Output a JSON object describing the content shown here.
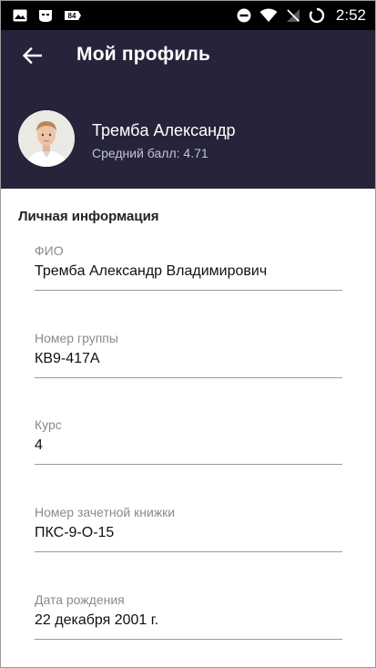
{
  "status_bar": {
    "time": "2:52",
    "left_icons": [
      "image-icon",
      "app-icon",
      "notification-count-icon"
    ],
    "notification_badge": "84",
    "right_icons": [
      "do-not-disturb-icon",
      "wifi-icon",
      "signal-icon",
      "battery-icon"
    ]
  },
  "header": {
    "back_icon": "arrow-left-icon",
    "title": "Мой профиль",
    "user_name": "Трембa Александр",
    "gpa_text": "Средний балл: 4.71"
  },
  "personal_info": {
    "section_title": "Личная информация",
    "fields": [
      {
        "label": "ФИО",
        "value": "Трембa Александр Владимирович"
      },
      {
        "label": "Номер группы",
        "value": "КВ9-417А"
      },
      {
        "label": "Курс",
        "value": "4"
      },
      {
        "label": "Номер зачетной книжки",
        "value": "ПКС-9-О-15"
      },
      {
        "label": "Дата рождения",
        "value": "22 декабря 2001 г."
      }
    ]
  },
  "colors": {
    "header_bg": "#25243a",
    "status_bar_bg": "#000000",
    "divider": "#9b9b9b",
    "label": "#8a8a8a"
  }
}
